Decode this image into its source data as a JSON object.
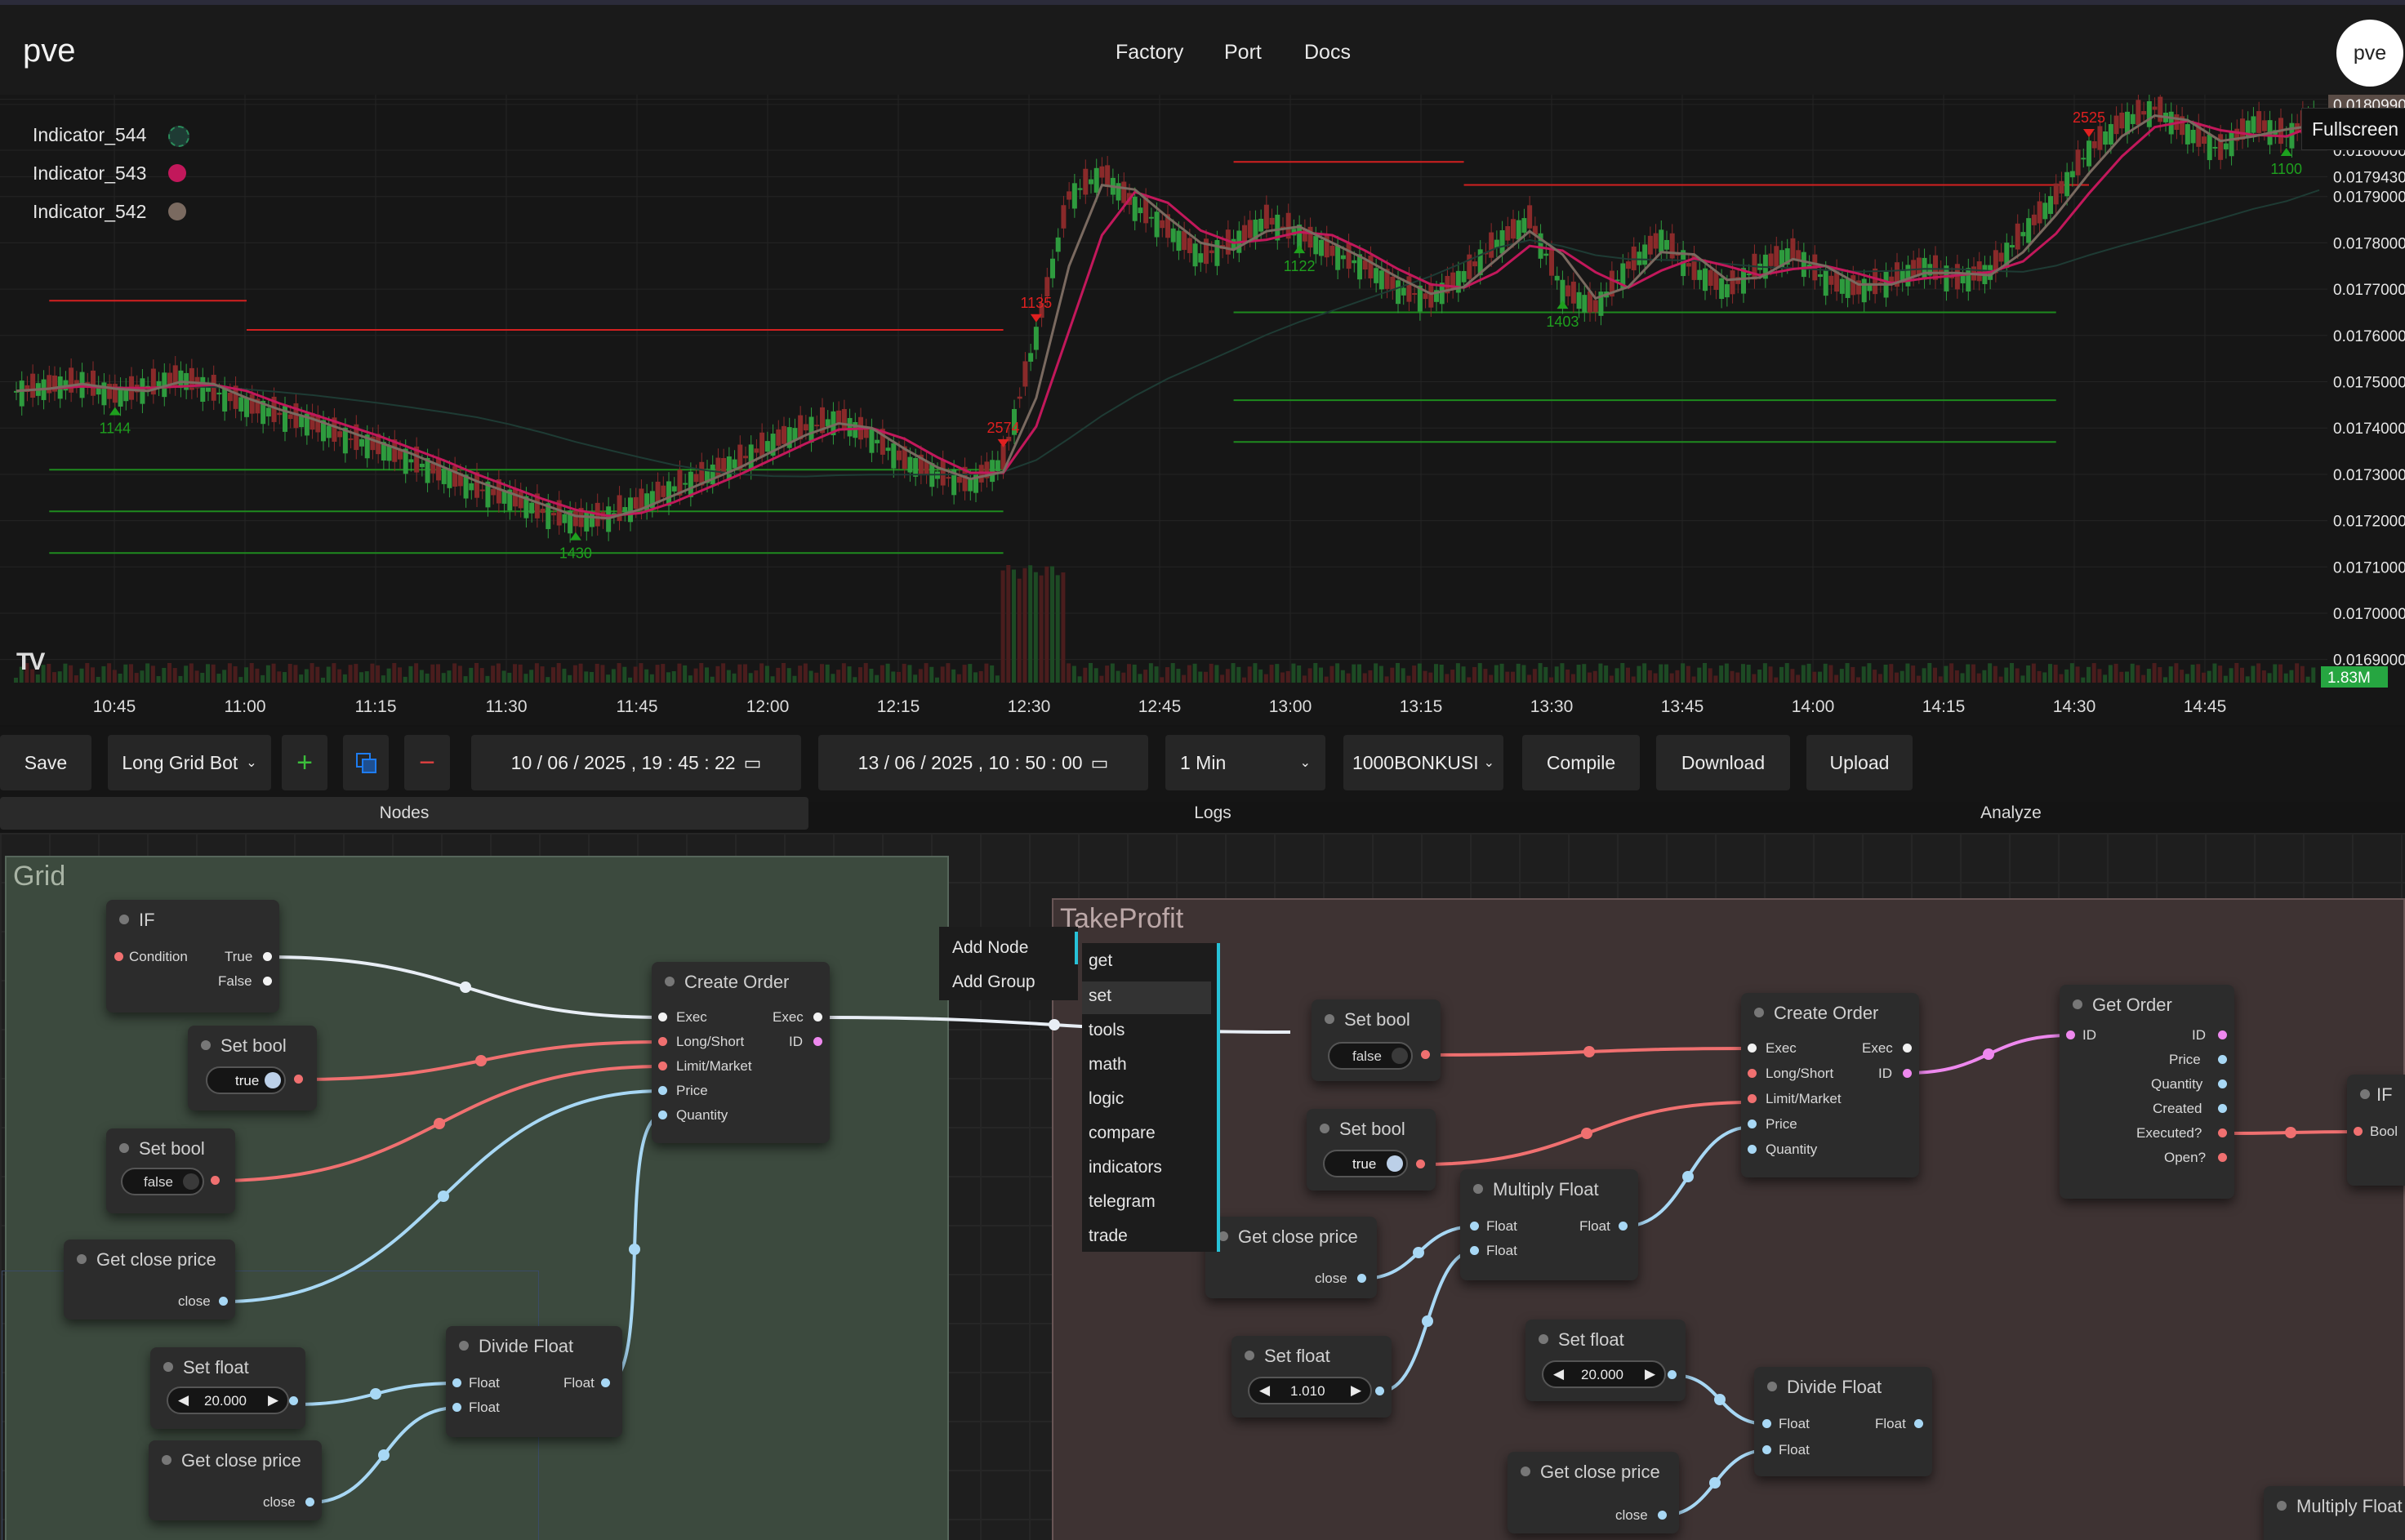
{
  "app": {
    "brand": "pve",
    "avatar": "pve"
  },
  "nav": {
    "factory": "Factory",
    "port": "Port",
    "docs": "Docs"
  },
  "chart_data": {
    "type": "candlestick",
    "y_range": [
      0.01685,
      0.01812
    ],
    "price_ticks": [
      "0.0181100",
      "0.0180990",
      "0.0180000",
      "0.0179430",
      "0.0179000",
      "0.0178000",
      "0.0177000",
      "0.0176000",
      "0.0175000",
      "0.0174000",
      "0.0173000",
      "0.0172000",
      "0.0171000",
      "0.0170000",
      "0.0169000"
    ],
    "price_tick_values": [
      0.01811,
      0.018099,
      0.018,
      0.017943,
      0.0179,
      0.0178,
      0.0177,
      0.0176,
      0.0175,
      0.0174,
      0.0173,
      0.0172,
      0.0171,
      0.017,
      0.0169
    ],
    "time_ticks": [
      "10:45",
      "11:00",
      "11:15",
      "11:30",
      "11:45",
      "12:00",
      "12:15",
      "12:30",
      "12:45",
      "13:00",
      "13:15",
      "13:30",
      "13:45",
      "14:00",
      "14:15",
      "14:30",
      "14:45"
    ],
    "volume_label": "1.83M",
    "legend": [
      {
        "name": "Indicator_544",
        "color": "#1e3b34"
      },
      {
        "name": "Indicator_543",
        "color": "#c2185b"
      },
      {
        "name": "Indicator_542",
        "color": "#7a6a60"
      }
    ],
    "close_series": [
      0.01748,
      0.01749,
      0.0175,
      0.01747,
      0.01749,
      0.01751,
      0.01748,
      0.01745,
      0.01743,
      0.01741,
      0.01738,
      0.01736,
      0.01733,
      0.0173,
      0.01727,
      0.01725,
      0.01722,
      0.0172,
      0.01721,
      0.01724,
      0.01727,
      0.0173,
      0.01733,
      0.01737,
      0.0174,
      0.01742,
      0.01738,
      0.01733,
      0.0173,
      0.01728,
      0.01733,
      0.0176,
      0.0179,
      0.01795,
      0.01788,
      0.01783,
      0.01777,
      0.0178,
      0.01785,
      0.01782,
      0.01778,
      0.01775,
      0.0177,
      0.01768,
      0.01773,
      0.0178,
      0.01785,
      0.0177,
      0.01766,
      0.01775,
      0.01781,
      0.01774,
      0.0177,
      0.01775,
      0.01778,
      0.01772,
      0.0177,
      0.01772,
      0.01775,
      0.01772,
      0.01774,
      0.01782,
      0.0179,
      0.018,
      0.01806,
      0.01809,
      0.01804,
      0.018,
      0.01806,
      0.01803,
      0.01808
    ],
    "markers": [
      {
        "label": "1135",
        "dir": "sell",
        "time_index": 31
      },
      {
        "label": "2574",
        "dir": "sell",
        "time_index": 30
      },
      {
        "label": "2525",
        "dir": "sell",
        "time_index": 63
      },
      {
        "label": "1144",
        "dir": "buy",
        "time_index": 3
      },
      {
        "label": "1430",
        "dir": "buy",
        "time_index": 17
      },
      {
        "label": "1122",
        "dir": "buy",
        "time_index": 39
      },
      {
        "label": "1403",
        "dir": "buy",
        "time_index": 47
      },
      {
        "label": "1100",
        "dir": "buy",
        "time_index": 69
      }
    ],
    "levels": [
      {
        "price": 0.017675,
        "color": "#d32020",
        "from": 1,
        "to": 7
      },
      {
        "price": 0.017612,
        "color": "#d32020",
        "from": 7,
        "to": 30
      },
      {
        "price": 0.017975,
        "color": "#d32020",
        "from": 37,
        "to": 44
      },
      {
        "price": 0.017925,
        "color": "#d32020",
        "from": 44,
        "to": 63
      },
      {
        "price": 0.01731,
        "color": "#1e8a1e",
        "from": 1,
        "to": 30
      },
      {
        "price": 0.01722,
        "color": "#1e8a1e",
        "from": 1,
        "to": 30
      },
      {
        "price": 0.01713,
        "color": "#1e8a1e",
        "from": 1,
        "to": 30
      },
      {
        "price": 0.01765,
        "color": "#1e8a1e",
        "from": 37,
        "to": 62
      },
      {
        "price": 0.01746,
        "color": "#1e8a1e",
        "from": 37,
        "to": 62
      },
      {
        "price": 0.01737,
        "color": "#1e8a1e",
        "from": 37,
        "to": 62
      }
    ]
  },
  "fullscreen": "Fullscreen",
  "toolbar": {
    "save": "Save",
    "bot": "Long Grid Bot",
    "add": "+",
    "remove": "−",
    "start_date": "10 / 06 / 2025 ,  19 : 45 : 22",
    "end_date": "13 / 06 / 2025 ,  10 : 50 : 00",
    "interval": "1 Min",
    "symbol": "1000BONKUSI",
    "compile": "Compile",
    "download": "Download",
    "upload": "Upload"
  },
  "tabs": {
    "nodes": "Nodes",
    "logs": "Logs",
    "analyze": "Analyze"
  },
  "groups": {
    "grid": "Grid",
    "takeprofit": "TakeProfit"
  },
  "nodes": {
    "if1": {
      "title": "IF",
      "condition": "Condition",
      "true": "True",
      "false": "False"
    },
    "setbool1": {
      "title": "Set bool",
      "value": "true"
    },
    "setbool2": {
      "title": "Set bool",
      "value": "false"
    },
    "create1": {
      "title": "Create Order",
      "exec": "Exec",
      "long": "Long/Short",
      "limit": "Limit/Market",
      "price": "Price",
      "qty": "Quantity",
      "exec_out": "Exec",
      "id_out": "ID"
    },
    "getclose1": {
      "title": "Get close price",
      "out": "close"
    },
    "setfloat1": {
      "title": "Set float",
      "value": "20.000"
    },
    "divide1": {
      "title": "Divide Float",
      "in1": "Float",
      "in2": "Float",
      "out": "Float"
    },
    "getclose2": {
      "title": "Get close price",
      "out": "close"
    },
    "setbool3": {
      "title": "Set bool",
      "value": "false"
    },
    "setbool4": {
      "title": "Set bool",
      "value": "true"
    },
    "create2": {
      "title": "Create Order",
      "exec": "Exec",
      "long": "Long/Short",
      "limit": "Limit/Market",
      "price": "Price",
      "qty": "Quantity",
      "exec_out": "Exec",
      "id_out": "ID"
    },
    "getorder": {
      "title": "Get Order",
      "id_in": "ID",
      "id": "ID",
      "price": "Price",
      "qty": "Quantity",
      "created": "Created",
      "executed": "Executed?",
      "open": "Open?"
    },
    "if2": {
      "title": "IF",
      "bool": "Bool"
    },
    "multiply1": {
      "title": "Multiply Float",
      "in1": "Float",
      "in2": "Float",
      "out": "Float"
    },
    "getclose3": {
      "title": "Get close price",
      "out": "close"
    },
    "setfloat2": {
      "title": "Set float",
      "value": "1.010"
    },
    "setfloat3": {
      "title": "Set float",
      "value": "20.000"
    },
    "divide2": {
      "title": "Divide Float",
      "in1": "Float",
      "in2": "Float",
      "out": "Float"
    },
    "getclose4": {
      "title": "Get close price",
      "out": "close"
    },
    "multiply2": {
      "title": "Multiply Float"
    }
  },
  "context_menu": {
    "add_node": "Add Node",
    "add_group": "Add Group"
  },
  "submenu": [
    "get",
    "set",
    "tools",
    "math",
    "logic",
    "compare",
    "indicators",
    "telegram",
    "trade"
  ]
}
